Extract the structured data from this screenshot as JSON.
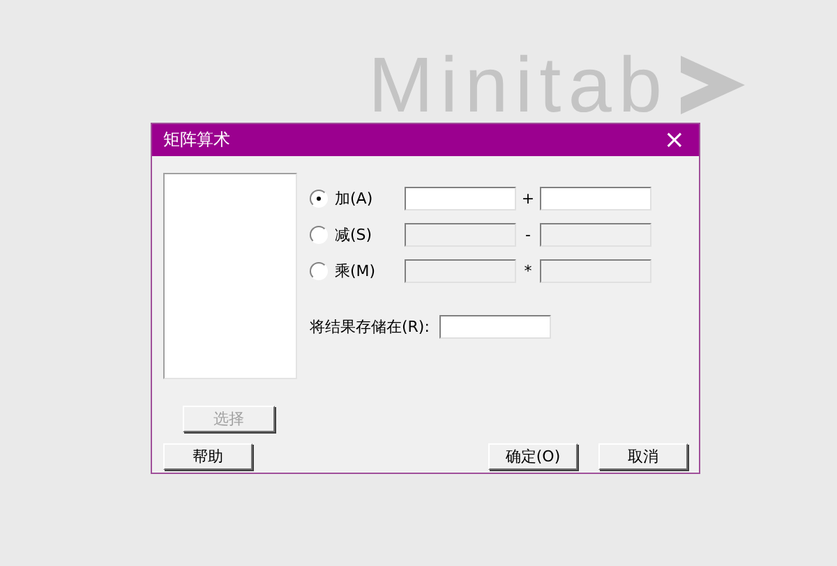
{
  "logo": {
    "text": "Minitab"
  },
  "window": {
    "title": "矩阵算术",
    "close": "×"
  },
  "operations": [
    {
      "label": "加(A)",
      "operator": "+",
      "selected": true
    },
    {
      "label": "减(S)",
      "operator": "-",
      "selected": false
    },
    {
      "label": "乘(M)",
      "operator": "*",
      "selected": false
    }
  ],
  "store": {
    "label": "将结果存储在(R):"
  },
  "select_button": {
    "label": "选择",
    "disabled": true
  },
  "buttons": [
    {
      "label": "帮助",
      "kind": "help"
    },
    {
      "label": "确定(O)",
      "kind": "ok"
    },
    {
      "label": "取消",
      "kind": "cancel"
    }
  ]
}
